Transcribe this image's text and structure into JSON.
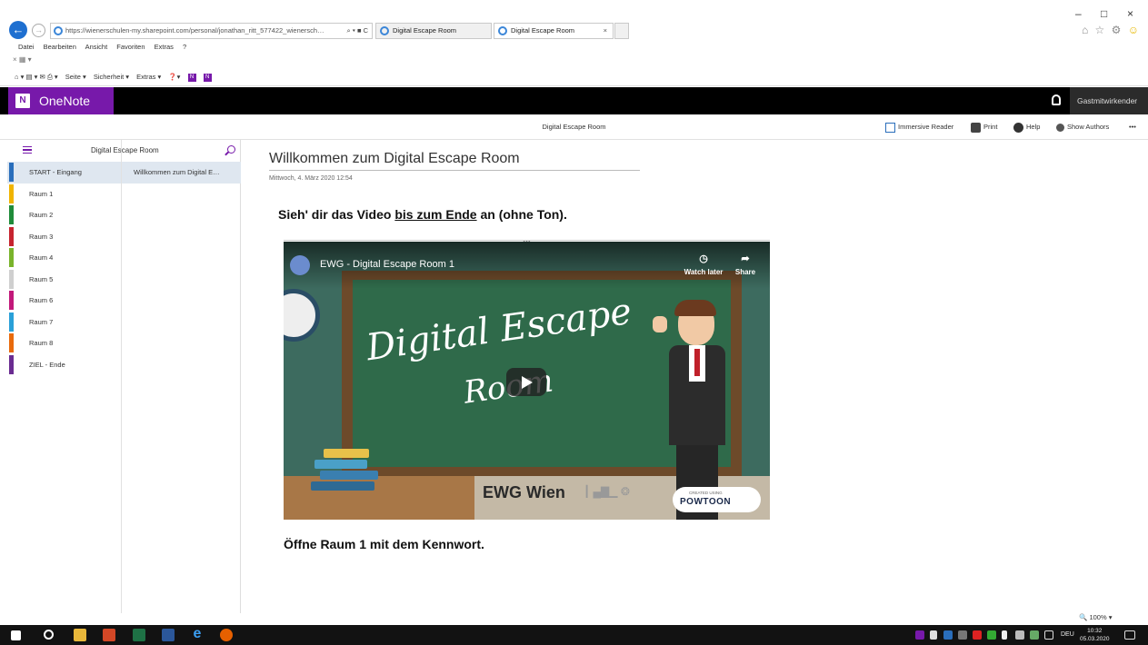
{
  "browser": {
    "address_url": "https://wienerschulen-my.sharepoint.com/personal/jonathan_ritt_577422_wienersch…",
    "address_tools": "⌕ ▾ ■ C",
    "tabs": [
      {
        "label": "Digital Escape Room",
        "active": false
      },
      {
        "label": "Digital Escape Room",
        "active": true
      }
    ],
    "tab_close": "×",
    "window_controls": {
      "minimize": "–",
      "maximize": "□",
      "close": "×"
    },
    "fav_icons": "⌂ ☆ ⚙",
    "smiley": "☺",
    "menu": [
      "Datei",
      "Bearbeiten",
      "Ansicht",
      "Favoriten",
      "Extras",
      "?"
    ],
    "row2": "×  ▦ ▾",
    "command_bar": [
      "Seite ▾",
      "Sicherheit ▾",
      "Extras ▾"
    ],
    "command_bar_prefix": "⌂ ▾ ▤ ▾ ✉ ⎙ ▾",
    "command_bar_help": "❓▾",
    "command_bar_on1": "N",
    "command_bar_on2": "N"
  },
  "onenote": {
    "app_name": "OneNote",
    "logo_letter": "N",
    "guest_label": "Gastmitwirkender"
  },
  "ribbon": {
    "title": "Digital Escape Room",
    "immersive_reader": "Immersive Reader",
    "print": "Print",
    "help": "Help",
    "show_authors": "Show Authors",
    "more": "•••"
  },
  "notebook": {
    "title": "Digital Escape Room",
    "sections": [
      {
        "label": "START - Eingang",
        "color": "#2a6ebb",
        "selected": true
      },
      {
        "label": "Raum 1",
        "color": "#f0b400"
      },
      {
        "label": "Raum 2",
        "color": "#1f8b3a"
      },
      {
        "label": "Raum 3",
        "color": "#c6242f"
      },
      {
        "label": "Raum 4",
        "color": "#79b32b"
      },
      {
        "label": "Raum 5",
        "color": "#cfcfcf"
      },
      {
        "label": "Raum 6",
        "color": "#c2197a"
      },
      {
        "label": "Raum 7",
        "color": "#2aa0d8"
      },
      {
        "label": "Raum 8",
        "color": "#e86a0c"
      },
      {
        "label": "ZIEL - Ende",
        "color": "#6a2c91"
      }
    ],
    "pages": [
      {
        "label": "Willkommen zum Digital E…",
        "selected": true
      }
    ]
  },
  "page": {
    "title": "Willkommen zum Digital Escape Room",
    "date": "Mittwoch, 4. März 2020   12:54",
    "instruction_part1": "Sieh' dir das Video ",
    "instruction_underlined": "bis zum Ende",
    "instruction_part2": " an (ohne Ton).",
    "instruction_2": "Öffne Raum 1 mit dem Kennwort."
  },
  "video": {
    "drag_handle": "•••",
    "title": "EWG - Digital Escape Room 1",
    "watch_later": "Watch later",
    "share": "Share",
    "chalk_line1": "Digital Escape",
    "chalk_line2": "Room",
    "brand": "EWG Wien",
    "skyline": "┃ ▄▇▁ ❂",
    "powtoon_small": "CREATED USING",
    "powtoon_big": "POWTOON"
  },
  "status": {
    "zoom": "100%"
  },
  "taskbar": {
    "tray_text": "DEU",
    "time": "10:32",
    "date": "05.03.2020"
  }
}
